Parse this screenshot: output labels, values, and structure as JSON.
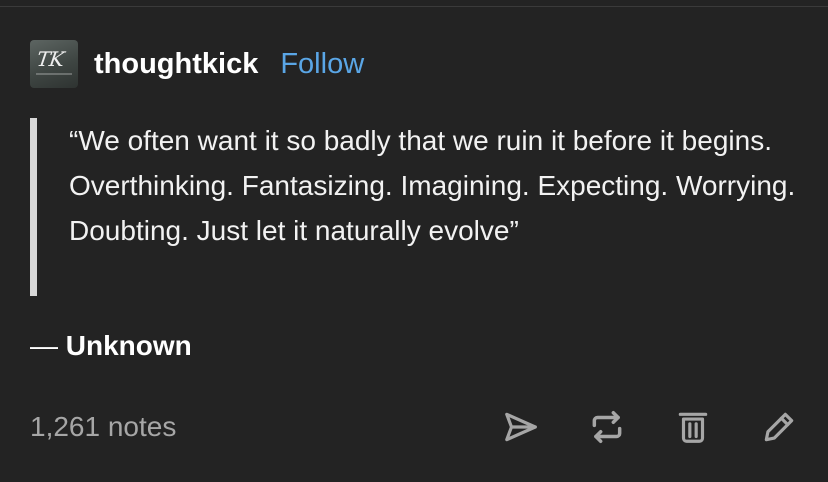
{
  "post": {
    "author": {
      "username": "thoughtkick",
      "avatar_monogram": "TK",
      "follow_label": "Follow"
    },
    "quote": "“We often want it so badly that we ruin it before it begins. Overthinking. Fantasizing. Imagining. Expecting. Worrying. Doubting. Just let it naturally evolve”",
    "attribution": {
      "dash": "—",
      "source": "Unknown"
    },
    "notes_label": "1,261 notes",
    "actions": [
      {
        "name": "share",
        "icon": "send-icon"
      },
      {
        "name": "reblog",
        "icon": "reblog-icon"
      },
      {
        "name": "delete",
        "icon": "trash-icon"
      },
      {
        "name": "edit",
        "icon": "pencil-icon"
      }
    ]
  },
  "colors": {
    "background": "#232323",
    "text": "#ffffff",
    "follow_link": "#5aa6e6",
    "muted": "#a6a6a6",
    "quote_bar": "#d8d8d8",
    "icon": "#a6a6a6"
  }
}
